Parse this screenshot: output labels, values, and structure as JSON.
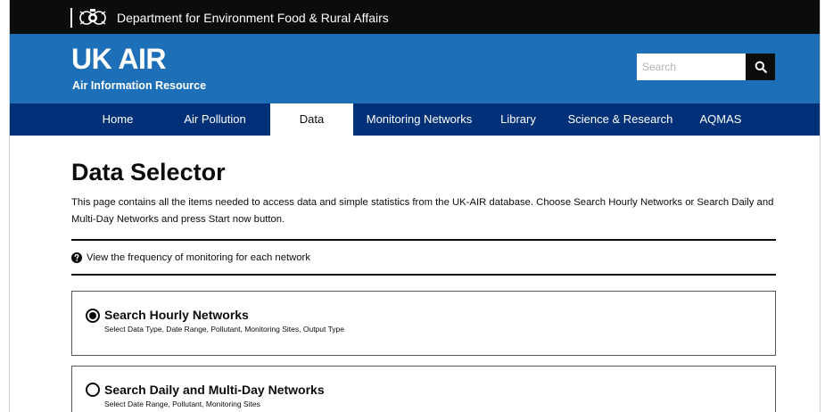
{
  "header": {
    "department": "Department for Environment Food & Rural Affairs",
    "brand_title": "UK AIR",
    "brand_subtitle": "Air Information Resource",
    "search_placeholder": "Search"
  },
  "nav": {
    "items": [
      {
        "label": "Home",
        "active": false
      },
      {
        "label": "Air Pollution",
        "active": false
      },
      {
        "label": "Data",
        "active": true
      },
      {
        "label": "Monitoring Networks",
        "active": false
      },
      {
        "label": "Library",
        "active": false
      },
      {
        "label": "Science & Research",
        "active": false
      },
      {
        "label": "AQMAS",
        "active": false
      }
    ]
  },
  "main": {
    "title": "Data Selector",
    "intro": "This page contains all the items needed to access data and simple statistics from the UK-AIR database. Choose Search Hourly Networks or Search Daily and Multi-Day Networks and press Start now button.",
    "frequency_link": "View the frequency of monitoring for each network",
    "options": [
      {
        "title": "Search Hourly Networks",
        "subtitle": "Select Data Type, Date Range, Pollutant, Monitoring Sites, Output Type",
        "selected": true
      },
      {
        "title": "Search Daily and Multi-Day Networks",
        "subtitle": "Select Date Range, Pollutant, Monitoring Sites",
        "selected": false
      }
    ]
  },
  "colors": {
    "gov_bar": "#0b0c0c",
    "brand": "#1d70b8",
    "nav": "#003078",
    "text": "#0b0c0c"
  },
  "icons": {
    "crest": "royal-crest-icon",
    "search": "search-icon",
    "help": "question-circle-icon"
  }
}
